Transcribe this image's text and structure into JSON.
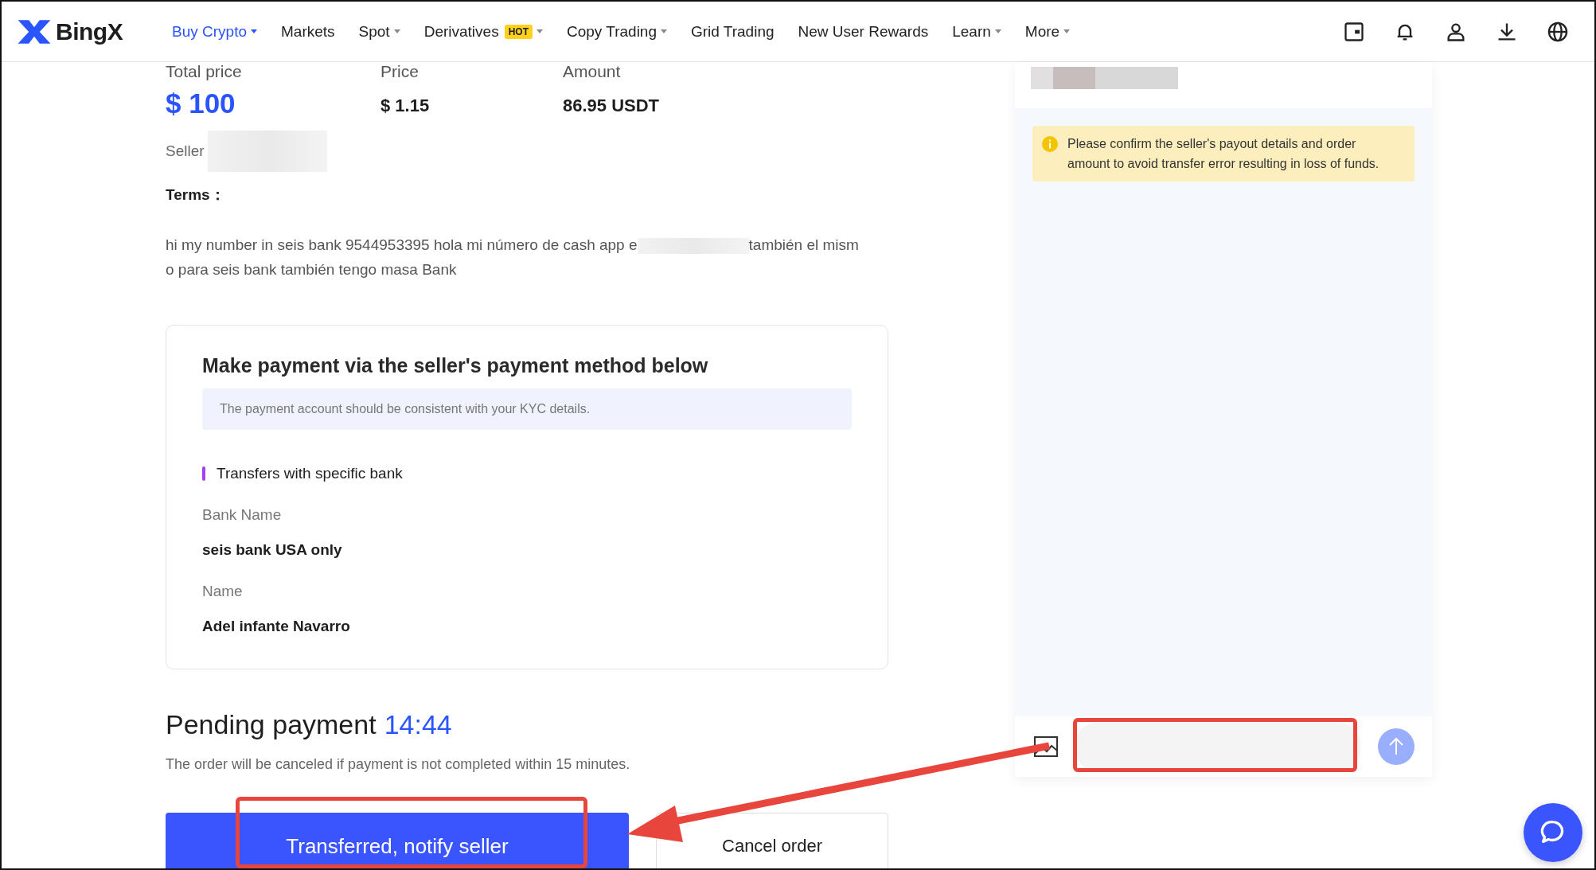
{
  "header": {
    "logo": "BingX",
    "nav": [
      {
        "label": "Buy Crypto",
        "selected": true,
        "dropdown": true
      },
      {
        "label": "Markets",
        "selected": false,
        "dropdown": false
      },
      {
        "label": "Spot",
        "selected": false,
        "dropdown": true
      },
      {
        "label": "Derivatives",
        "selected": false,
        "dropdown": true,
        "badge": "HOT"
      },
      {
        "label": "Copy Trading",
        "selected": false,
        "dropdown": true
      },
      {
        "label": "Grid Trading",
        "selected": false,
        "dropdown": false
      },
      {
        "label": "New User Rewards",
        "selected": false,
        "dropdown": false
      },
      {
        "label": "Learn",
        "selected": false,
        "dropdown": true
      },
      {
        "label": "More",
        "selected": false,
        "dropdown": true
      }
    ]
  },
  "order": {
    "stats": [
      {
        "label": "Total price",
        "value": "$ 100",
        "kind": "highlight"
      },
      {
        "label": "Price",
        "value": "$ 1.15",
        "kind": "plain"
      },
      {
        "label": "Amount",
        "value": "86.95 USDT",
        "kind": "plain"
      }
    ],
    "seller_label": "Seller",
    "terms_label": "Terms：",
    "terms": {
      "line_1_before": "hi my number in seis bank 9544953395 hola mi número de cash app e",
      "line_1_after": "también el mism",
      "line_2": "o para seis bank también tengo masa Bank"
    }
  },
  "payment_card": {
    "title": "Make payment via the seller's payment method below",
    "notice": "The payment account should be consistent with your KYC details.",
    "method": "Transfers with specific bank",
    "fields": [
      {
        "label": "Bank Name",
        "value": "seis bank USA only"
      },
      {
        "label": "Name",
        "value": "Adel infante Navarro"
      }
    ]
  },
  "pending": {
    "title": "Pending payment",
    "timer": "14:44",
    "note": "The order will be canceled if payment is not completed within 15 minutes."
  },
  "buttons": [
    {
      "label": "Transferred, notify seller",
      "kind": "primary"
    },
    {
      "label": "Cancel order",
      "kind": "secondary"
    }
  ],
  "chat": {
    "warning": "Please confirm the seller's payout details and order amount to avoid transfer error resulting in loss of funds."
  }
}
